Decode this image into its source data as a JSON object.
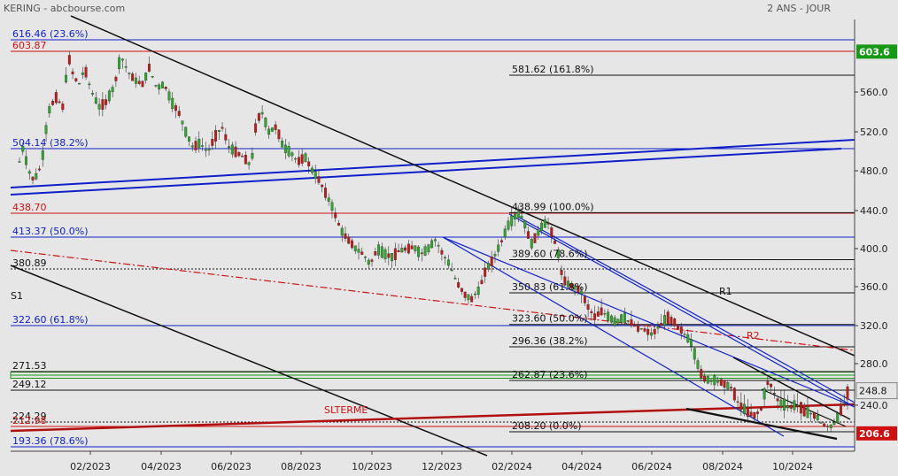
{
  "header": {
    "title_left": "KERING - abcbourse.com",
    "title_right": "2 ANS - JOUR"
  },
  "colors": {
    "background": "#e6e6e6",
    "blue": "#1020c8",
    "red": "#d01010",
    "black": "#111111",
    "green": "#169a16",
    "dark_red": "#b01010"
  },
  "chart_data": {
    "type": "candlestick",
    "ylim": [
      190,
      625
    ],
    "y_ticks": [
      "560.0",
      "520.0",
      "480.0",
      "440.0",
      "400.0",
      "360.0",
      "320.0",
      "280.0",
      "240.0"
    ],
    "x_ticks": [
      "02/2023",
      "04/2023",
      "06/2023",
      "08/2023",
      "10/2023",
      "12/2023",
      "02/2024",
      "04/2024",
      "06/2024",
      "08/2024",
      "10/2024"
    ],
    "last_price_label": "248.8",
    "max_price_label": "603.6",
    "low_price_label": "206.6",
    "horizontal_levels_left": [
      {
        "label": "616.46  (23.6%)",
        "value": 616.46,
        "color": "blue"
      },
      {
        "label": "603.87",
        "value": 603.87,
        "color": "red"
      },
      {
        "label": "504.14  (38.2%)",
        "value": 504.14,
        "color": "blue"
      },
      {
        "label": "438.70",
        "value": 438.7,
        "color": "red"
      },
      {
        "label": "413.37  (50.0%)",
        "value": 413.37,
        "color": "blue"
      },
      {
        "label": "380.89",
        "value": 380.89,
        "color": "black",
        "dotted": true
      },
      {
        "label": "322.60  (61.8%)",
        "value": 322.6,
        "color": "blue"
      },
      {
        "label": "271.53",
        "value": 271.53,
        "color": "black"
      },
      {
        "label": "249.12",
        "value": 249.12,
        "color": "black"
      },
      {
        "label": "224.29",
        "value": 224.29,
        "color": "black",
        "dotted": true
      },
      {
        "label": "212.98",
        "value": 212.98,
        "color": "red"
      },
      {
        "label": "193.36  (78.6%)",
        "value": 193.36,
        "color": "blue"
      }
    ],
    "fib_levels_right": [
      {
        "label": "581.62  (161.8%)",
        "value": 581.62
      },
      {
        "label": "438.99  (100.0%)",
        "value": 438.99
      },
      {
        "label": "389.60  (78.6%)",
        "value": 389.6
      },
      {
        "label": "350.83  (61.8%)",
        "value": 350.83
      },
      {
        "label": "323.60  (50.0%)",
        "value": 323.6
      },
      {
        "label": "296.36  (38.2%)",
        "value": 296.36
      },
      {
        "label": "262.87  (23.6%)",
        "value": 262.87
      },
      {
        "label": "208.20  (0.0%)",
        "value": 208.2
      }
    ],
    "annotations": {
      "s1": "S1",
      "r1": "R1",
      "r2": "R2",
      "slterme": "SLTERME"
    },
    "price_path": [
      [
        0.0,
        490
      ],
      [
        0.01,
        505
      ],
      [
        0.025,
        480
      ],
      [
        0.04,
        470
      ],
      [
        0.06,
        485
      ],
      [
        0.08,
        540
      ],
      [
        0.1,
        555
      ],
      [
        0.12,
        545
      ],
      [
        0.135,
        600
      ],
      [
        0.15,
        580
      ],
      [
        0.165,
        570
      ],
      [
        0.18,
        590
      ],
      [
        0.2,
        560
      ],
      [
        0.22,
        545
      ],
      [
        0.24,
        550
      ],
      [
        0.26,
        565
      ],
      [
        0.28,
        600
      ],
      [
        0.3,
        585
      ],
      [
        0.32,
        575
      ],
      [
        0.34,
        570
      ],
      [
        0.36,
        590
      ],
      [
        0.38,
        565
      ],
      [
        0.4,
        570
      ],
      [
        0.42,
        550
      ],
      [
        0.44,
        540
      ],
      [
        0.46,
        520
      ],
      [
        0.48,
        505
      ],
      [
        0.5,
        510
      ],
      [
        0.52,
        500
      ],
      [
        0.54,
        515
      ],
      [
        0.56,
        525
      ],
      [
        0.58,
        505
      ],
      [
        0.6,
        500
      ],
      [
        0.62,
        495
      ],
      [
        0.64,
        485
      ],
      [
        0.655,
        530
      ],
      [
        0.67,
        540
      ],
      [
        0.69,
        520
      ],
      [
        0.71,
        525
      ],
      [
        0.73,
        505
      ],
      [
        0.75,
        500
      ],
      [
        0.77,
        490
      ],
      [
        0.79,
        495
      ],
      [
        0.81,
        480
      ],
      [
        0.83,
        470
      ],
      [
        0.85,
        455
      ],
      [
        0.87,
        440
      ],
      [
        0.89,
        420
      ],
      [
        0.91,
        410
      ],
      [
        0.93,
        400
      ],
      [
        0.95,
        395
      ],
      [
        0.97,
        385
      ],
      [
        0.99,
        400
      ],
      [
        1.01,
        395
      ],
      [
        1.03,
        392
      ],
      [
        1.05,
        398
      ],
      [
        1.07,
        400
      ],
      [
        1.09,
        402
      ],
      [
        1.11,
        395
      ],
      [
        1.13,
        400
      ],
      [
        1.15,
        410
      ],
      [
        1.17,
        395
      ],
      [
        1.19,
        385
      ],
      [
        1.21,
        365
      ],
      [
        1.23,
        350
      ],
      [
        1.25,
        345
      ],
      [
        1.27,
        355
      ],
      [
        1.29,
        380
      ],
      [
        1.31,
        390
      ],
      [
        1.33,
        405
      ],
      [
        1.35,
        425
      ],
      [
        1.37,
        435
      ],
      [
        1.385,
        438
      ],
      [
        1.4,
        425
      ],
      [
        1.415,
        405
      ],
      [
        1.43,
        415
      ],
      [
        1.445,
        425
      ],
      [
        1.46,
        430
      ],
      [
        1.475,
        415
      ],
      [
        1.49,
        395
      ],
      [
        1.5,
        375
      ],
      [
        1.51,
        365
      ],
      [
        1.53,
        360
      ],
      [
        1.55,
        355
      ],
      [
        1.57,
        340
      ],
      [
        1.59,
        330
      ],
      [
        1.61,
        335
      ],
      [
        1.63,
        330
      ],
      [
        1.65,
        325
      ],
      [
        1.67,
        330
      ],
      [
        1.69,
        325
      ],
      [
        1.71,
        318
      ],
      [
        1.73,
        315
      ],
      [
        1.75,
        310
      ],
      [
        1.77,
        320
      ],
      [
        1.79,
        330
      ],
      [
        1.81,
        325
      ],
      [
        1.83,
        315
      ],
      [
        1.85,
        305
      ],
      [
        1.86,
        300
      ],
      [
        1.87,
        285
      ],
      [
        1.88,
        275
      ],
      [
        1.89,
        265
      ],
      [
        1.91,
        262
      ],
      [
        1.93,
        262
      ],
      [
        1.95,
        258
      ],
      [
        1.97,
        252
      ],
      [
        1.99,
        240
      ],
      [
        2.01,
        235
      ],
      [
        2.03,
        230
      ],
      [
        2.05,
        235
      ],
      [
        2.07,
        260
      ],
      [
        2.08,
        255
      ],
      [
        2.09,
        245
      ],
      [
        2.11,
        240
      ],
      [
        2.13,
        238
      ],
      [
        2.15,
        240
      ],
      [
        2.17,
        235
      ],
      [
        2.19,
        232
      ],
      [
        2.21,
        228
      ],
      [
        2.22,
        220
      ],
      [
        2.23,
        215
      ],
      [
        2.24,
        212
      ],
      [
        2.25,
        218
      ],
      [
        2.26,
        225
      ],
      [
        2.27,
        235
      ],
      [
        2.28,
        240
      ],
      [
        2.29,
        248.8
      ]
    ]
  }
}
